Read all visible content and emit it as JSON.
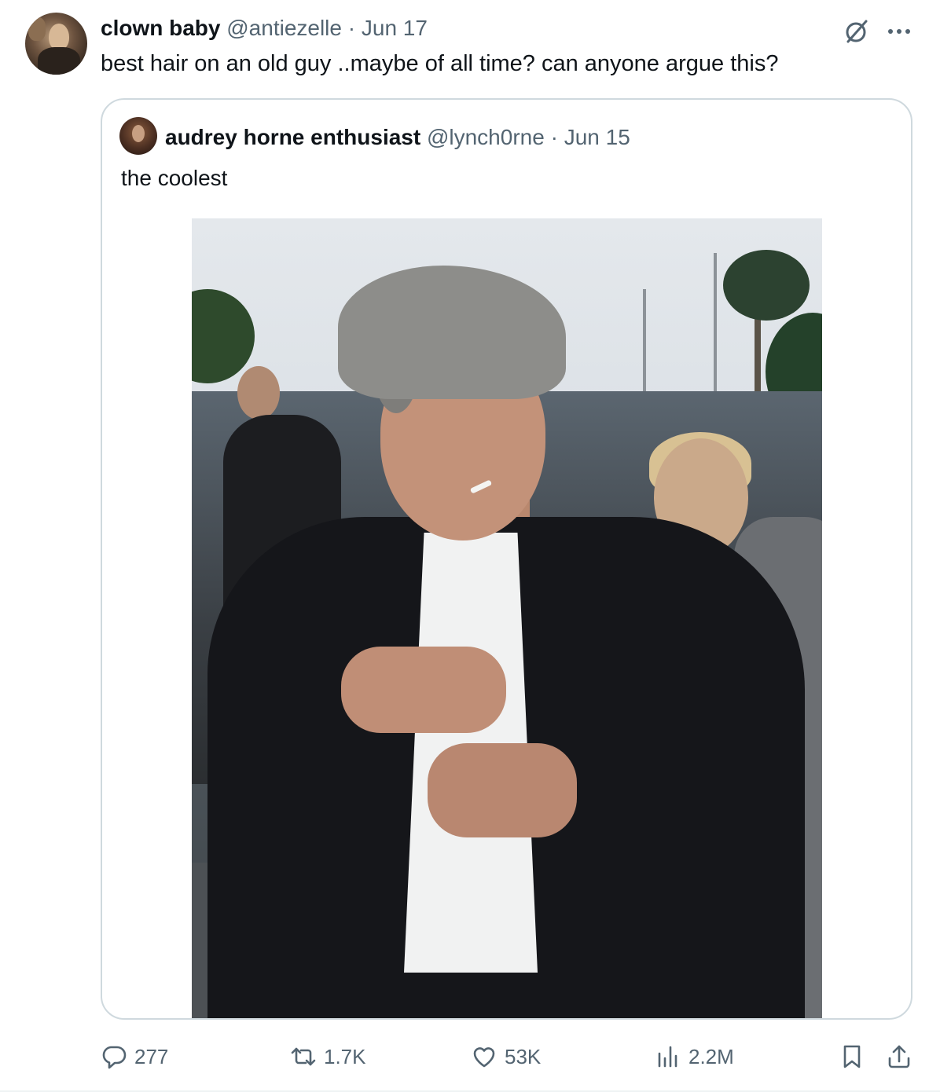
{
  "tweet": {
    "author": {
      "display_name": "clown baby",
      "handle": "@antiezelle",
      "separator": "·",
      "date": "Jun 17"
    },
    "text": "best hair on an old guy ..maybe of all time? can anyone argue this?",
    "header_icons": [
      "grok-icon",
      "more-icon"
    ],
    "more_label": "···"
  },
  "quoted_tweet": {
    "author": {
      "display_name": "audrey horne enthusiast",
      "handle": "@lynch0rne",
      "separator": "·",
      "date": "Jun 15"
    },
    "text": "the coolest",
    "media": "photo"
  },
  "actions": {
    "replies": "277",
    "reposts": "1.7K",
    "likes": "53K",
    "views": "2.2M",
    "icons": [
      "reply-icon",
      "repost-icon",
      "like-icon",
      "views-icon",
      "bookmark-icon",
      "share-icon"
    ]
  },
  "colors": {
    "text": "#0f1419",
    "muted": "#536471",
    "border": "#cfd9de"
  }
}
